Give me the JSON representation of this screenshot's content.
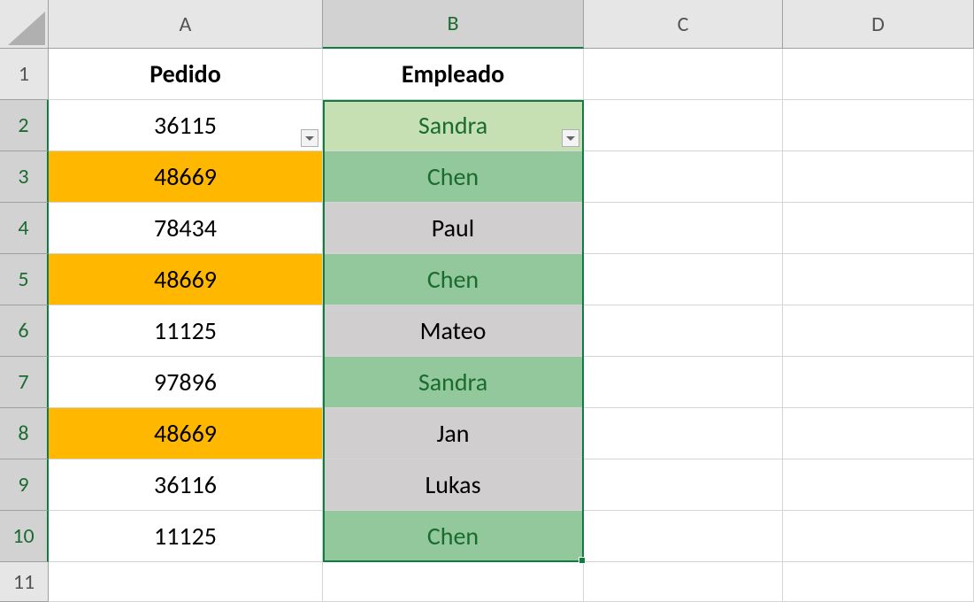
{
  "columns": [
    "A",
    "B",
    "C",
    "D"
  ],
  "rowNumbers": [
    "1",
    "2",
    "3",
    "4",
    "5",
    "6",
    "7",
    "8",
    "9",
    "10",
    "11"
  ],
  "headers": {
    "A": "Pedido",
    "B": "Empleado"
  },
  "rows": [
    {
      "pedido": "36115",
      "empleado": "Sandra",
      "pedidoClass": "",
      "empClass": "light-green green-text"
    },
    {
      "pedido": "48669",
      "empleado": "Chen",
      "pedidoClass": "orange",
      "empClass": "mid-green green-text"
    },
    {
      "pedido": "78434",
      "empleado": "Paul",
      "pedidoClass": "",
      "empClass": "grey"
    },
    {
      "pedido": "48669",
      "empleado": "Chen",
      "pedidoClass": "orange",
      "empClass": "mid-green green-text"
    },
    {
      "pedido": "11125",
      "empleado": "Mateo",
      "pedidoClass": "",
      "empClass": "grey"
    },
    {
      "pedido": "97896",
      "empleado": "Sandra",
      "pedidoClass": "",
      "empClass": "mid-green green-text"
    },
    {
      "pedido": "48669",
      "empleado": "Jan",
      "pedidoClass": "orange",
      "empClass": "grey"
    },
    {
      "pedido": "36116",
      "empleado": "Lukas",
      "pedidoClass": "",
      "empClass": "grey"
    },
    {
      "pedido": "11125",
      "empleado": "Chen",
      "pedidoClass": "",
      "empClass": "mid-green green-text"
    }
  ],
  "selection": {
    "col": "B",
    "fromRow": 2,
    "toRow": 10
  },
  "activeCell": {
    "col": "B",
    "row": 2
  }
}
